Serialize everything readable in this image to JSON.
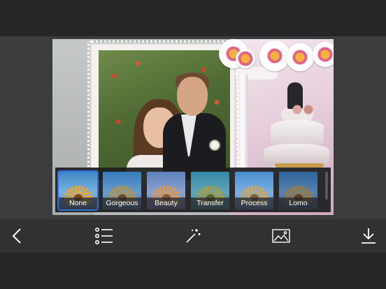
{
  "filters": [
    {
      "label": "None",
      "selected": true,
      "tint": "rgba(0,0,0,0)"
    },
    {
      "label": "Gorgeous",
      "selected": false,
      "tint": "rgba(40,90,150,0.25)"
    },
    {
      "label": "Beauty",
      "selected": false,
      "tint": "rgba(180,120,160,0.28)"
    },
    {
      "label": "Transfer",
      "selected": false,
      "tint": "rgba(40,140,110,0.35)"
    },
    {
      "label": "Process",
      "selected": false,
      "tint": "rgba(120,170,230,0.22)"
    },
    {
      "label": "Lomo",
      "selected": false,
      "tint": "rgba(20,40,80,0.35)"
    }
  ],
  "toolbar": [
    {
      "icon": "chevron-left-icon",
      "action": "back"
    },
    {
      "icon": "list-icon",
      "action": "frames"
    },
    {
      "icon": "magic-wand-icon",
      "action": "effects"
    },
    {
      "icon": "image-icon",
      "action": "gallery"
    },
    {
      "icon": "download-icon",
      "action": "save"
    }
  ],
  "colors": {
    "selected_border": "#2f6fd8",
    "toolbar_bg": "#313133",
    "background": "#262628"
  }
}
